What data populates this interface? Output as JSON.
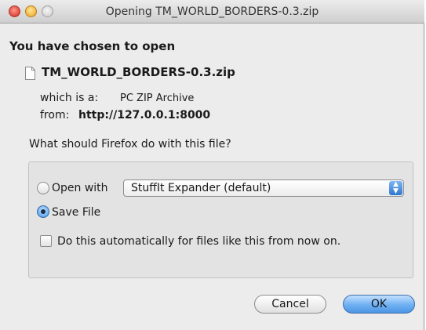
{
  "window": {
    "title": "Opening TM_WORLD_BORDERS-0.3.zip"
  },
  "dialog": {
    "heading": "You have chosen to open",
    "file_name": "TM_WORLD_BORDERS-0.3.zip",
    "which_label": "which is a:",
    "which_value": "PC ZIP Archive",
    "from_label": "from:",
    "from_value": "http://127.0.0.1:8000",
    "question": "What should Firefox do with this file?"
  },
  "options": {
    "open_with_label": "Open with",
    "open_with_app": "StuffIt Expander (default)",
    "save_file_label": "Save File",
    "selected": "Save File",
    "auto_label": "Do this automatically for files like this from now on.",
    "auto_checked": false
  },
  "buttons": {
    "cancel": "Cancel",
    "ok": "OK"
  },
  "colors": {
    "accent": "#4c95e5"
  },
  "icons": [
    "close-button-icon",
    "minimize-button-icon",
    "zoom-button-icon",
    "document-icon",
    "popup-arrows-icon"
  ]
}
